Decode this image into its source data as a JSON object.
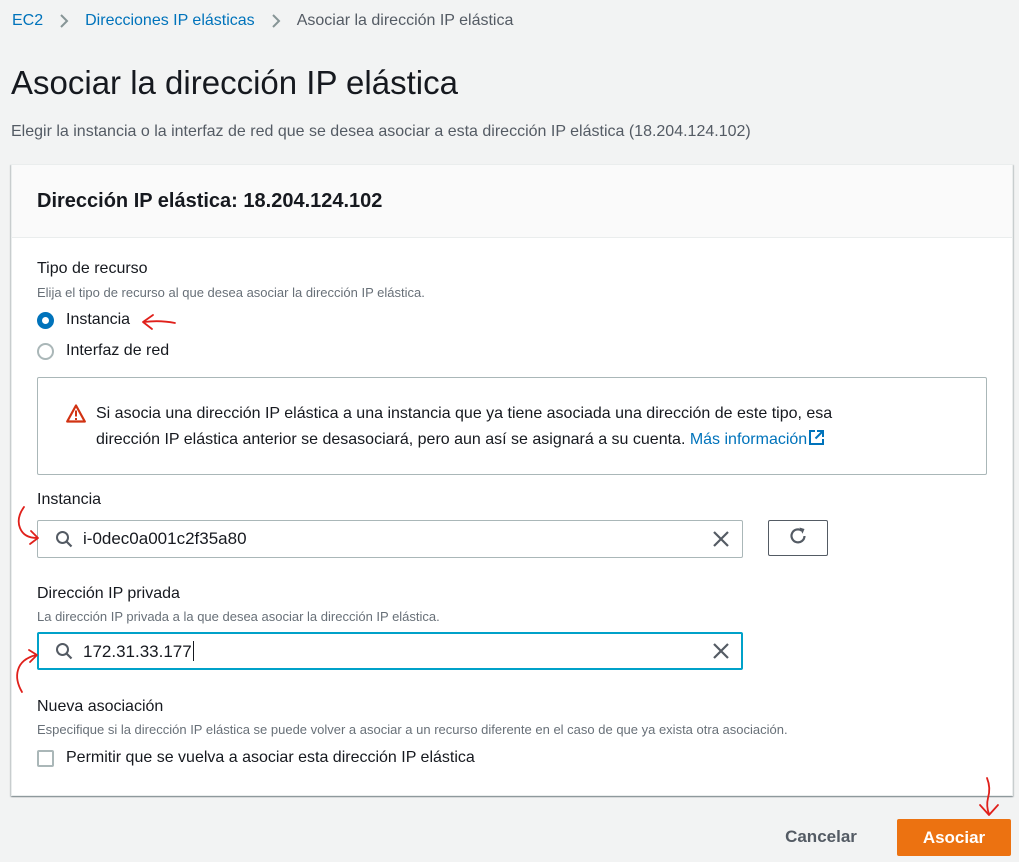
{
  "breadcrumb": {
    "items": [
      "EC2",
      "Direcciones IP elásticas"
    ],
    "current": "Asociar la dirección IP elástica"
  },
  "page": {
    "title": "Asociar la dirección IP elástica",
    "description": "Elegir la instancia o la interfaz de red que se desea asociar a esta dirección IP elástica (18.204.124.102)"
  },
  "panel": {
    "title": "Dirección IP elástica: 18.204.124.102"
  },
  "resource_type": {
    "label": "Tipo de recurso",
    "description": "Elija el tipo de recurso al que desea asociar la dirección IP elástica.",
    "options": [
      {
        "label": "Instancia",
        "checked": true
      },
      {
        "label": "Interfaz de red",
        "checked": false
      }
    ]
  },
  "alert": {
    "text_line1": "Si asocia una dirección IP elástica a una instancia que ya tiene asociada una dirección de este tipo, esa",
    "text_line2": "dirección IP elástica anterior se desasociará, pero aun así se asignará a su cuenta. ",
    "link": "Más información"
  },
  "instance": {
    "label": "Instancia",
    "value": "i-0dec0a001c2f35a80"
  },
  "private_ip": {
    "label": "Dirección IP privada",
    "description": "La dirección IP privada a la que desea asociar la dirección IP elástica.",
    "value": "172.31.33.177"
  },
  "reassociation": {
    "label": "Nueva asociación",
    "description": "Especifique si la dirección IP elástica se puede volver a asociar a un recurso diferente en el caso de que ya exista otra asociación.",
    "checkbox_label": "Permitir que se vuelva a asociar esta dirección IP elástica",
    "checked": false
  },
  "actions": {
    "cancel": "Cancelar",
    "submit": "Asociar"
  },
  "colors": {
    "link": "#0073bb",
    "primary": "#ec7211",
    "warning": "#d13212",
    "annotation": "#e0201b"
  },
  "icons": [
    "chevron-right-icon",
    "warning-icon",
    "external-link-icon",
    "search-icon",
    "clear-icon",
    "refresh-icon"
  ]
}
